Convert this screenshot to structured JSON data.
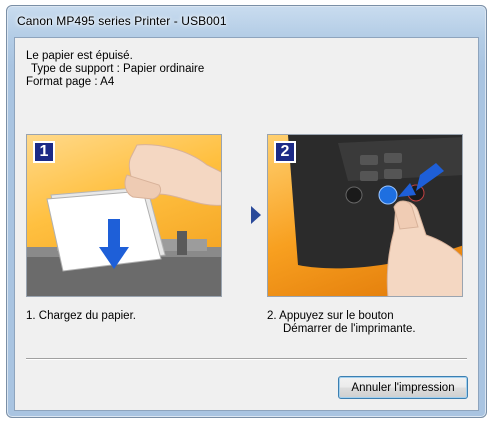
{
  "window": {
    "title": "Canon MP495 series Printer - USB001"
  },
  "message": {
    "line1": "Le papier est épuisé.",
    "line2": "Type de support : Papier ordinaire",
    "line3": "Format page : A4"
  },
  "steps": [
    {
      "number": "1",
      "caption_line1": "1.  Chargez du papier.",
      "caption_line2": ""
    },
    {
      "number": "2",
      "caption_line1": "2.  Appuyez sur le bouton",
      "caption_line2": "Démarrer de l'imprimante."
    }
  ],
  "buttons": {
    "cancel_label": "Annuler l'impression"
  },
  "colors": {
    "badge": "#1c2a86",
    "panel_orange": "#f5a42a",
    "printer_button_blue": "#1e6fe0"
  },
  "icons": {
    "step1_illustration": "hand-loading-paper",
    "step2_illustration": "finger-pressing-start-button",
    "separator": "play-arrow-icon"
  }
}
